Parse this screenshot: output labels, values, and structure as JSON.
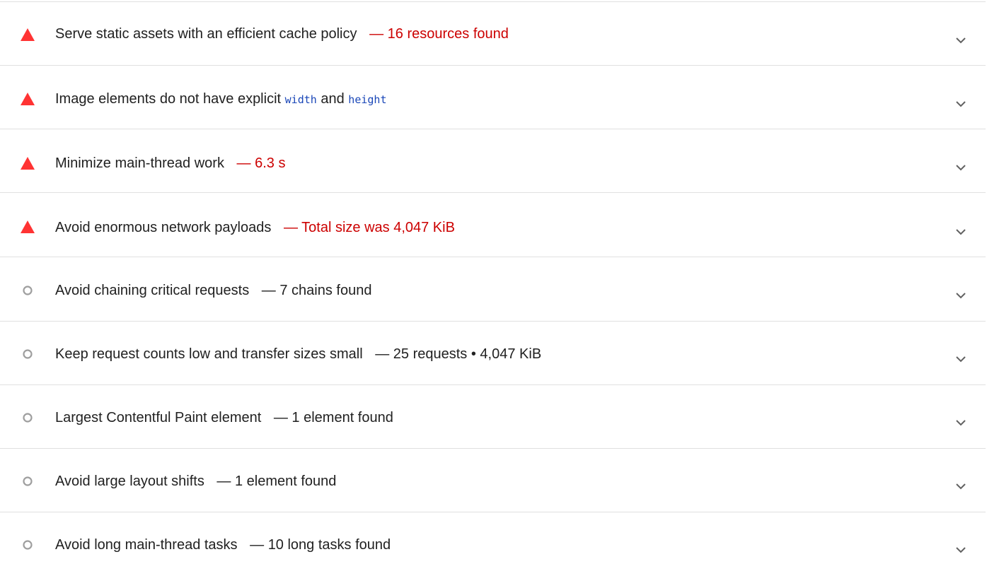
{
  "colors": {
    "fail": "#f33",
    "fail_text": "#cc0000",
    "neutral_icon": "#9e9e9e",
    "divider": "#e0e0e0",
    "code": "#1a47b8"
  },
  "audits": [
    {
      "status": "fail",
      "status_icon": "red-triangle-icon",
      "title": "Serve static assets with an efficient cache policy",
      "separator": "—",
      "display_value": "16 resources found"
    },
    {
      "status": "fail",
      "status_icon": "red-triangle-icon",
      "title_before": "Image elements do not have explicit",
      "code1": "width",
      "title_middle": "and",
      "code2": "height"
    },
    {
      "status": "fail",
      "status_icon": "red-triangle-icon",
      "title": "Minimize main-thread work",
      "separator": "—",
      "display_value": "6.3 s"
    },
    {
      "status": "fail",
      "status_icon": "red-triangle-icon",
      "title": "Avoid enormous network payloads",
      "separator": "—",
      "display_value": "Total size was 4,047 KiB"
    },
    {
      "status": "info",
      "status_icon": "gray-circle-icon",
      "title": "Avoid chaining critical requests",
      "separator": "—",
      "display_value": "7 chains found"
    },
    {
      "status": "info",
      "status_icon": "gray-circle-icon",
      "title": "Keep request counts low and transfer sizes small",
      "separator": "—",
      "display_value": "25 requests • 4,047 KiB"
    },
    {
      "status": "info",
      "status_icon": "gray-circle-icon",
      "title": "Largest Contentful Paint element",
      "separator": "—",
      "display_value": "1 element found"
    },
    {
      "status": "info",
      "status_icon": "gray-circle-icon",
      "title": "Avoid large layout shifts",
      "separator": "—",
      "display_value": "1 element found"
    },
    {
      "status": "info",
      "status_icon": "gray-circle-icon",
      "title": "Avoid long main-thread tasks",
      "separator": "—",
      "display_value": "10 long tasks found"
    }
  ]
}
